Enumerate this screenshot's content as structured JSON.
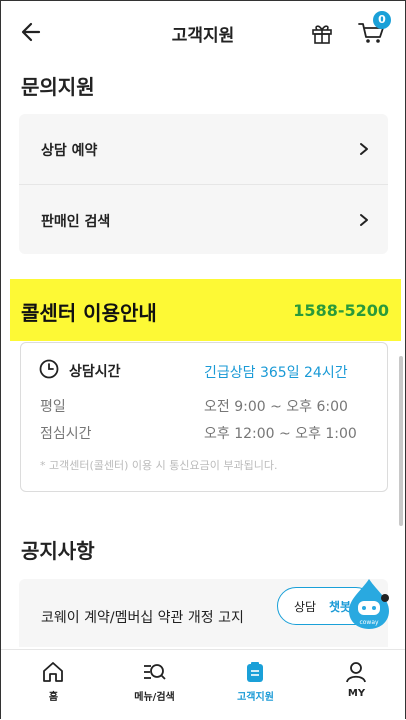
{
  "header": {
    "title": "고객지원",
    "cart_count": "0"
  },
  "inquiry": {
    "title": "문의지원",
    "items": [
      {
        "label": "상담 예약"
      },
      {
        "label": "판매인 검색"
      }
    ]
  },
  "call_center": {
    "label": "콜센터 이용안내",
    "phone": "1588-5200",
    "hours_title": "상담시간",
    "emergency": "긴급상담 365일 24시간",
    "rows": [
      {
        "label": "평일",
        "value": "오전 9:00 ~ 오후 6:00"
      },
      {
        "label": "점심시간",
        "value": "오후 12:00 ~ 오후 1:00"
      }
    ],
    "note": "* 고객센터(콜센터) 이용 시 통신요금이 부과됩니다."
  },
  "notice": {
    "title": "공지사항",
    "items": [
      {
        "label": "코웨이 계약/멤버십 약관 개정 고지"
      }
    ]
  },
  "chatbot": {
    "label_prefix": "상담",
    "label_highlight": "챗봇",
    "brand": "coway"
  },
  "tabbar": {
    "items": [
      {
        "label": "홈",
        "icon": "home-icon"
      },
      {
        "label": "메뉴/검색",
        "icon": "menu-search-icon"
      },
      {
        "label": "고객지원",
        "icon": "support-icon",
        "active": true
      },
      {
        "label": "MY",
        "icon": "user-icon"
      }
    ]
  },
  "colors": {
    "accent": "#1a9ad6",
    "banner": "#fdf935",
    "phone": "#2a9a3a"
  }
}
